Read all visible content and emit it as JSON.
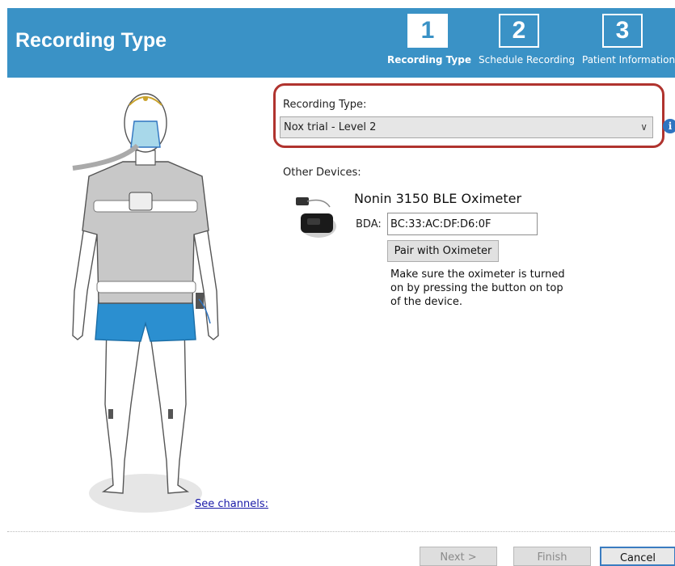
{
  "header": {
    "title": "Recording Type",
    "steps": [
      {
        "number": "1",
        "label": "Recording Type"
      },
      {
        "number": "2",
        "label": "Schedule Recording"
      },
      {
        "number": "3",
        "label": "Patient Information"
      }
    ],
    "active_step": 1,
    "color": "#3a92c6"
  },
  "figure": {
    "see_channels": "See channels:"
  },
  "recording": {
    "label": "Recording Type:",
    "selected": "Nox trial - Level 2",
    "highlight_color": "#b0332e"
  },
  "devices": {
    "label": "Other Devices:",
    "name": "Nonin 3150 BLE Oximeter",
    "bda_label": "BDA:",
    "bda_value": "BC:33:AC:DF:D6:0F",
    "pair_button": "Pair with Oximeter",
    "hint": "Make sure the oximeter is turned on by pressing the button on top of the device."
  },
  "footer": {
    "next": "Next >",
    "finish": "Finish",
    "cancel": "Cancel"
  }
}
